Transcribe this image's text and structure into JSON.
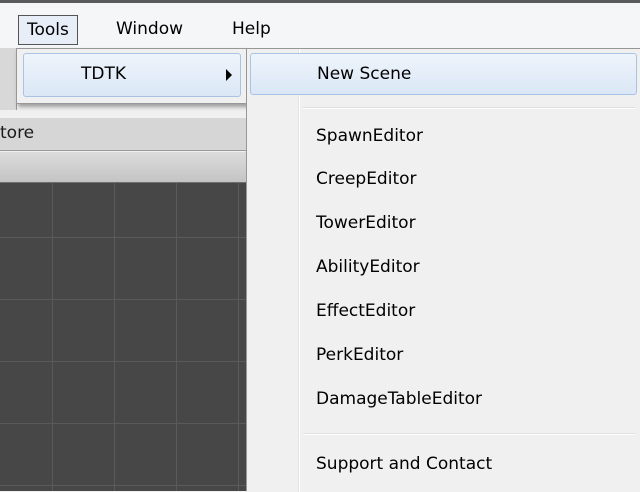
{
  "menubar": {
    "items": [
      {
        "label": "Tools",
        "active": true
      },
      {
        "label": "Window",
        "active": false
      },
      {
        "label": "Help",
        "active": false
      }
    ]
  },
  "panel": {
    "header_text": "tore"
  },
  "tools_menu": {
    "items": [
      {
        "label": "TDTK",
        "has_submenu": true
      }
    ]
  },
  "tdtk_menu": {
    "items": [
      {
        "label": "New Scene",
        "highlighted": true
      },
      {
        "label": "SpawnEditor"
      },
      {
        "label": "CreepEditor"
      },
      {
        "label": "TowerEditor"
      },
      {
        "label": "AbilityEditor"
      },
      {
        "label": "EffectEditor"
      },
      {
        "label": "PerkEditor"
      },
      {
        "label": "DamageTableEditor"
      },
      {
        "label": "Support and Contact"
      }
    ]
  },
  "colors": {
    "highlight_border": "#a8c4e4",
    "highlight_fill": "#dbe7f6",
    "scene_background": "#474747"
  }
}
